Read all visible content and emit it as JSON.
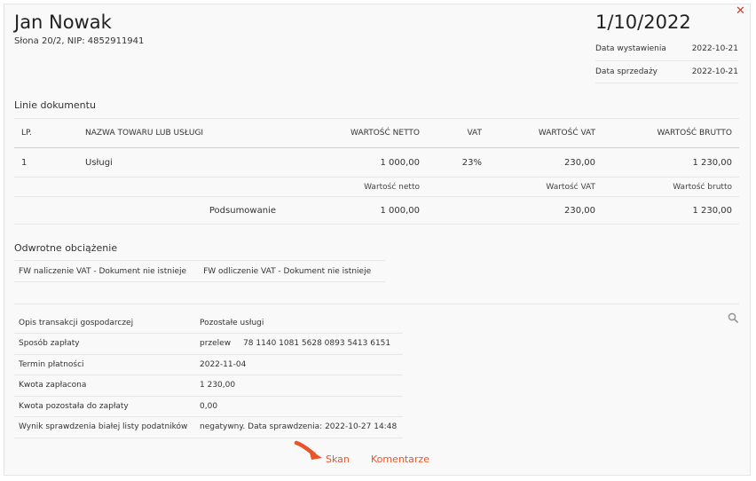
{
  "seller": {
    "name": "Jan Nowak",
    "address_line": "Słona 20/2, NIP: 4852911941"
  },
  "document": {
    "number": "1/10/2022",
    "dates": [
      {
        "label": "Data wystawienia",
        "value": "2022-10-21"
      },
      {
        "label": "Data sprzedaży",
        "value": "2022-10-21"
      }
    ]
  },
  "lines": {
    "title": "Linie dokumentu",
    "headers": {
      "lp": "LP.",
      "name": "NAZWA TOWARU LUB USŁUGI",
      "net": "WARTOŚĆ NETTO",
      "vat": "VAT",
      "vat_value": "WARTOŚĆ VAT",
      "gross": "WARTOŚĆ BRUTTO"
    },
    "rows": [
      {
        "lp": "1",
        "name": "Usługi",
        "net": "1 000,00",
        "vat": "23%",
        "vat_value": "230,00",
        "gross": "1 230,00"
      }
    ],
    "summary": {
      "net_label": "Wartość netto",
      "vat_label": "Wartość VAT",
      "gross_label": "Wartość brutto",
      "row_label": "Podsumowanie",
      "net": "1 000,00",
      "vat_value": "230,00",
      "gross": "1 230,00"
    }
  },
  "reverse_charge": {
    "title": "Odwrotne obciążenie",
    "items": [
      "FW naliczenie VAT - Dokument nie istnieje",
      "FW odliczenie VAT - Dokument nie istnieje"
    ]
  },
  "details": [
    {
      "label": "Opis transakcji gospodarczej",
      "value": "Pozostałe usługi",
      "extra": ""
    },
    {
      "label": "Sposób zapłaty",
      "value": "przelew",
      "extra": "78 1140 1081 5628 0893 5413 6151"
    },
    {
      "label": "Termin płatności",
      "value": "2022-11-04",
      "extra": ""
    },
    {
      "label": "Kwota zapłacona",
      "value": "1 230,00",
      "extra": ""
    },
    {
      "label": "Kwota pozostała do zapłaty",
      "value": "0,00",
      "extra": ""
    },
    {
      "label": "Wynik sprawdzenia białej listy podatników",
      "value": "negatywny. Data sprawdzenia: 2022-10-27 14:48",
      "extra": ""
    }
  ],
  "actions": {
    "scan": "Skan",
    "comments": "Komentarze"
  },
  "icons": {
    "close": "close-icon",
    "search": "search-icon",
    "pointer": "arrow-pointer-icon"
  },
  "colors": {
    "accent": "#e8552b",
    "close": "#d9362b"
  }
}
